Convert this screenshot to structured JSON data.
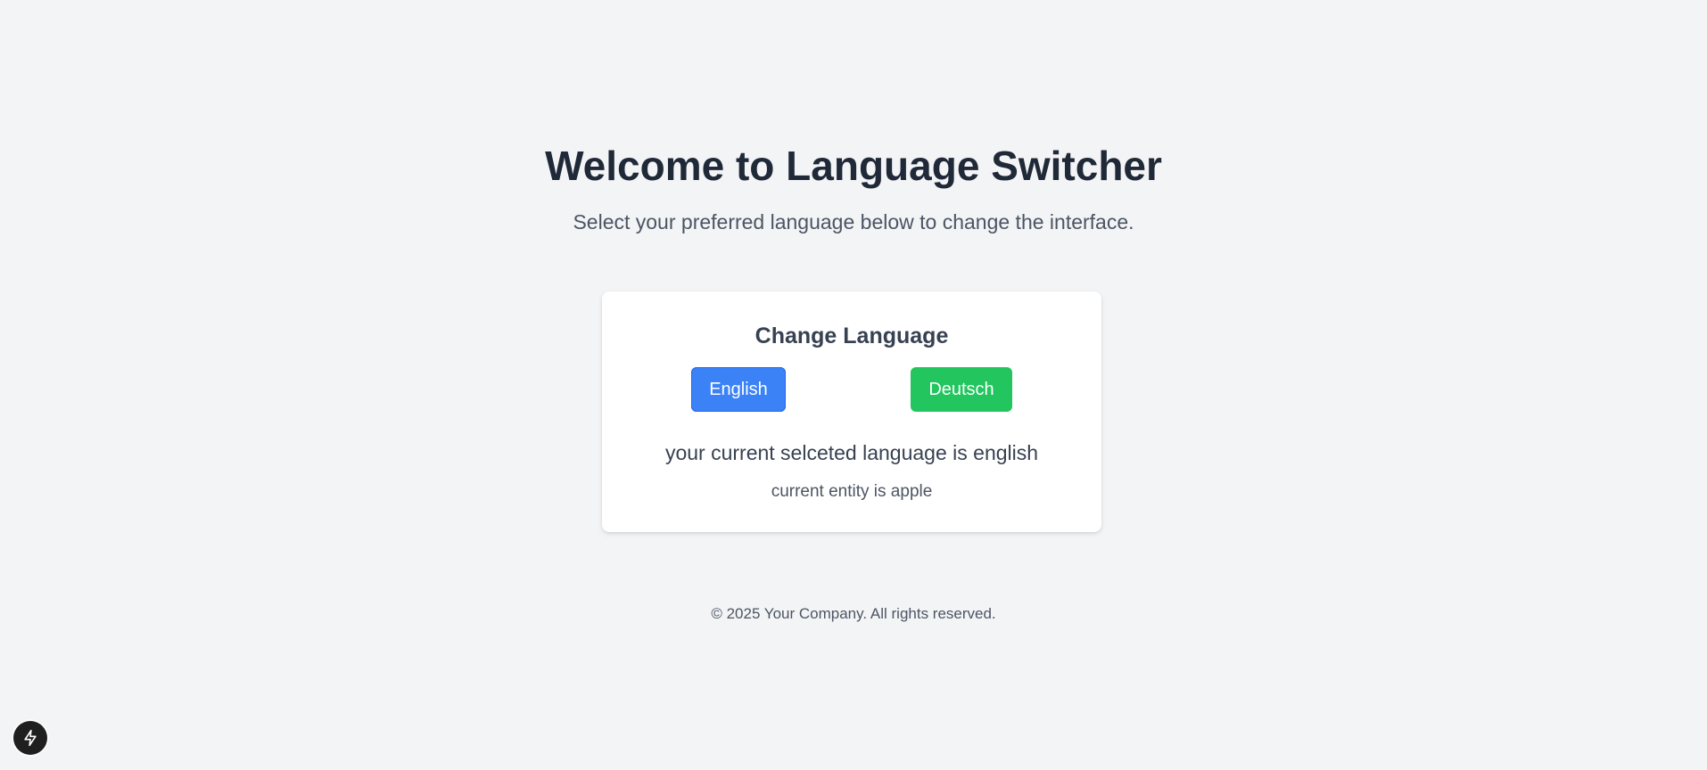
{
  "hero": {
    "title": "Welcome to Language Switcher",
    "subtitle": "Select your preferred language below to change the interface."
  },
  "card": {
    "title": "Change Language",
    "buttons": {
      "english_label": "English",
      "deutsch_label": "Deutsch"
    },
    "current_language_text": "your current selceted language is english",
    "current_entity_text": "current entity is apple"
  },
  "footer": {
    "text": "© 2025 Your Company. All rights reserved."
  },
  "fab": {
    "icon": "lightning-bolt-icon"
  },
  "colors": {
    "background": "#f3f4f6",
    "english_button": "#3b82f6",
    "deutsch_button": "#22c55e",
    "fab_background": "#1f1f1f"
  }
}
